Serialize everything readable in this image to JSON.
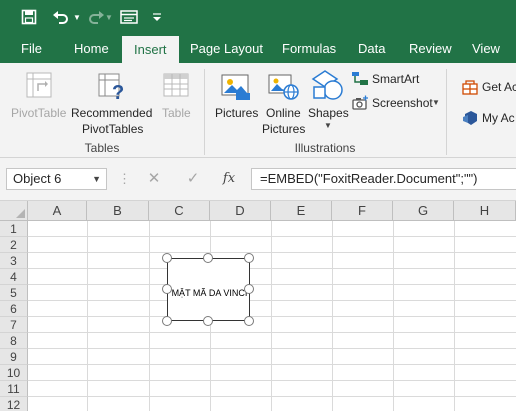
{
  "quick_access": {
    "save_icon": "save-icon",
    "undo_icon": "undo-icon",
    "redo_icon": "redo-icon",
    "form_icon": "form-icon",
    "customize_icon": "customize-toolbar-icon"
  },
  "tabs": [
    {
      "label": "File"
    },
    {
      "label": "Home"
    },
    {
      "label": "Insert"
    },
    {
      "label": "Page Layout"
    },
    {
      "label": "Formulas"
    },
    {
      "label": "Data"
    },
    {
      "label": "Review"
    },
    {
      "label": "View"
    }
  ],
  "active_tab": "Insert",
  "ribbon": {
    "tables": {
      "group_label": "Tables",
      "pivottable": "PivotTable",
      "recommended_line1": "Recommended",
      "recommended_line2": "PivotTables",
      "table": "Table"
    },
    "illustrations": {
      "group_label": "Illustrations",
      "pictures": "Pictures",
      "online_line1": "Online",
      "online_line2": "Pictures",
      "shapes": "Shapes",
      "smartart": "SmartArt",
      "screenshot": "Screenshot"
    },
    "addins": {
      "get": "Get Ac",
      "my": "My Ac"
    }
  },
  "formula_bar": {
    "name_box": "Object 6",
    "fx": "fx",
    "formula": "=EMBED(\"FoxitReader.Document\";\"\")"
  },
  "columns": [
    "A",
    "B",
    "C",
    "D",
    "E",
    "F",
    "G",
    "H"
  ],
  "rows": [
    "1",
    "2",
    "3",
    "4",
    "5",
    "6",
    "7",
    "8",
    "9",
    "10",
    "11",
    "12"
  ],
  "embedded_object": {
    "label": "MẬT MÃ DA VINCI"
  },
  "colors": {
    "accent": "#217346",
    "ribbon_bg": "#f3f3f3"
  }
}
